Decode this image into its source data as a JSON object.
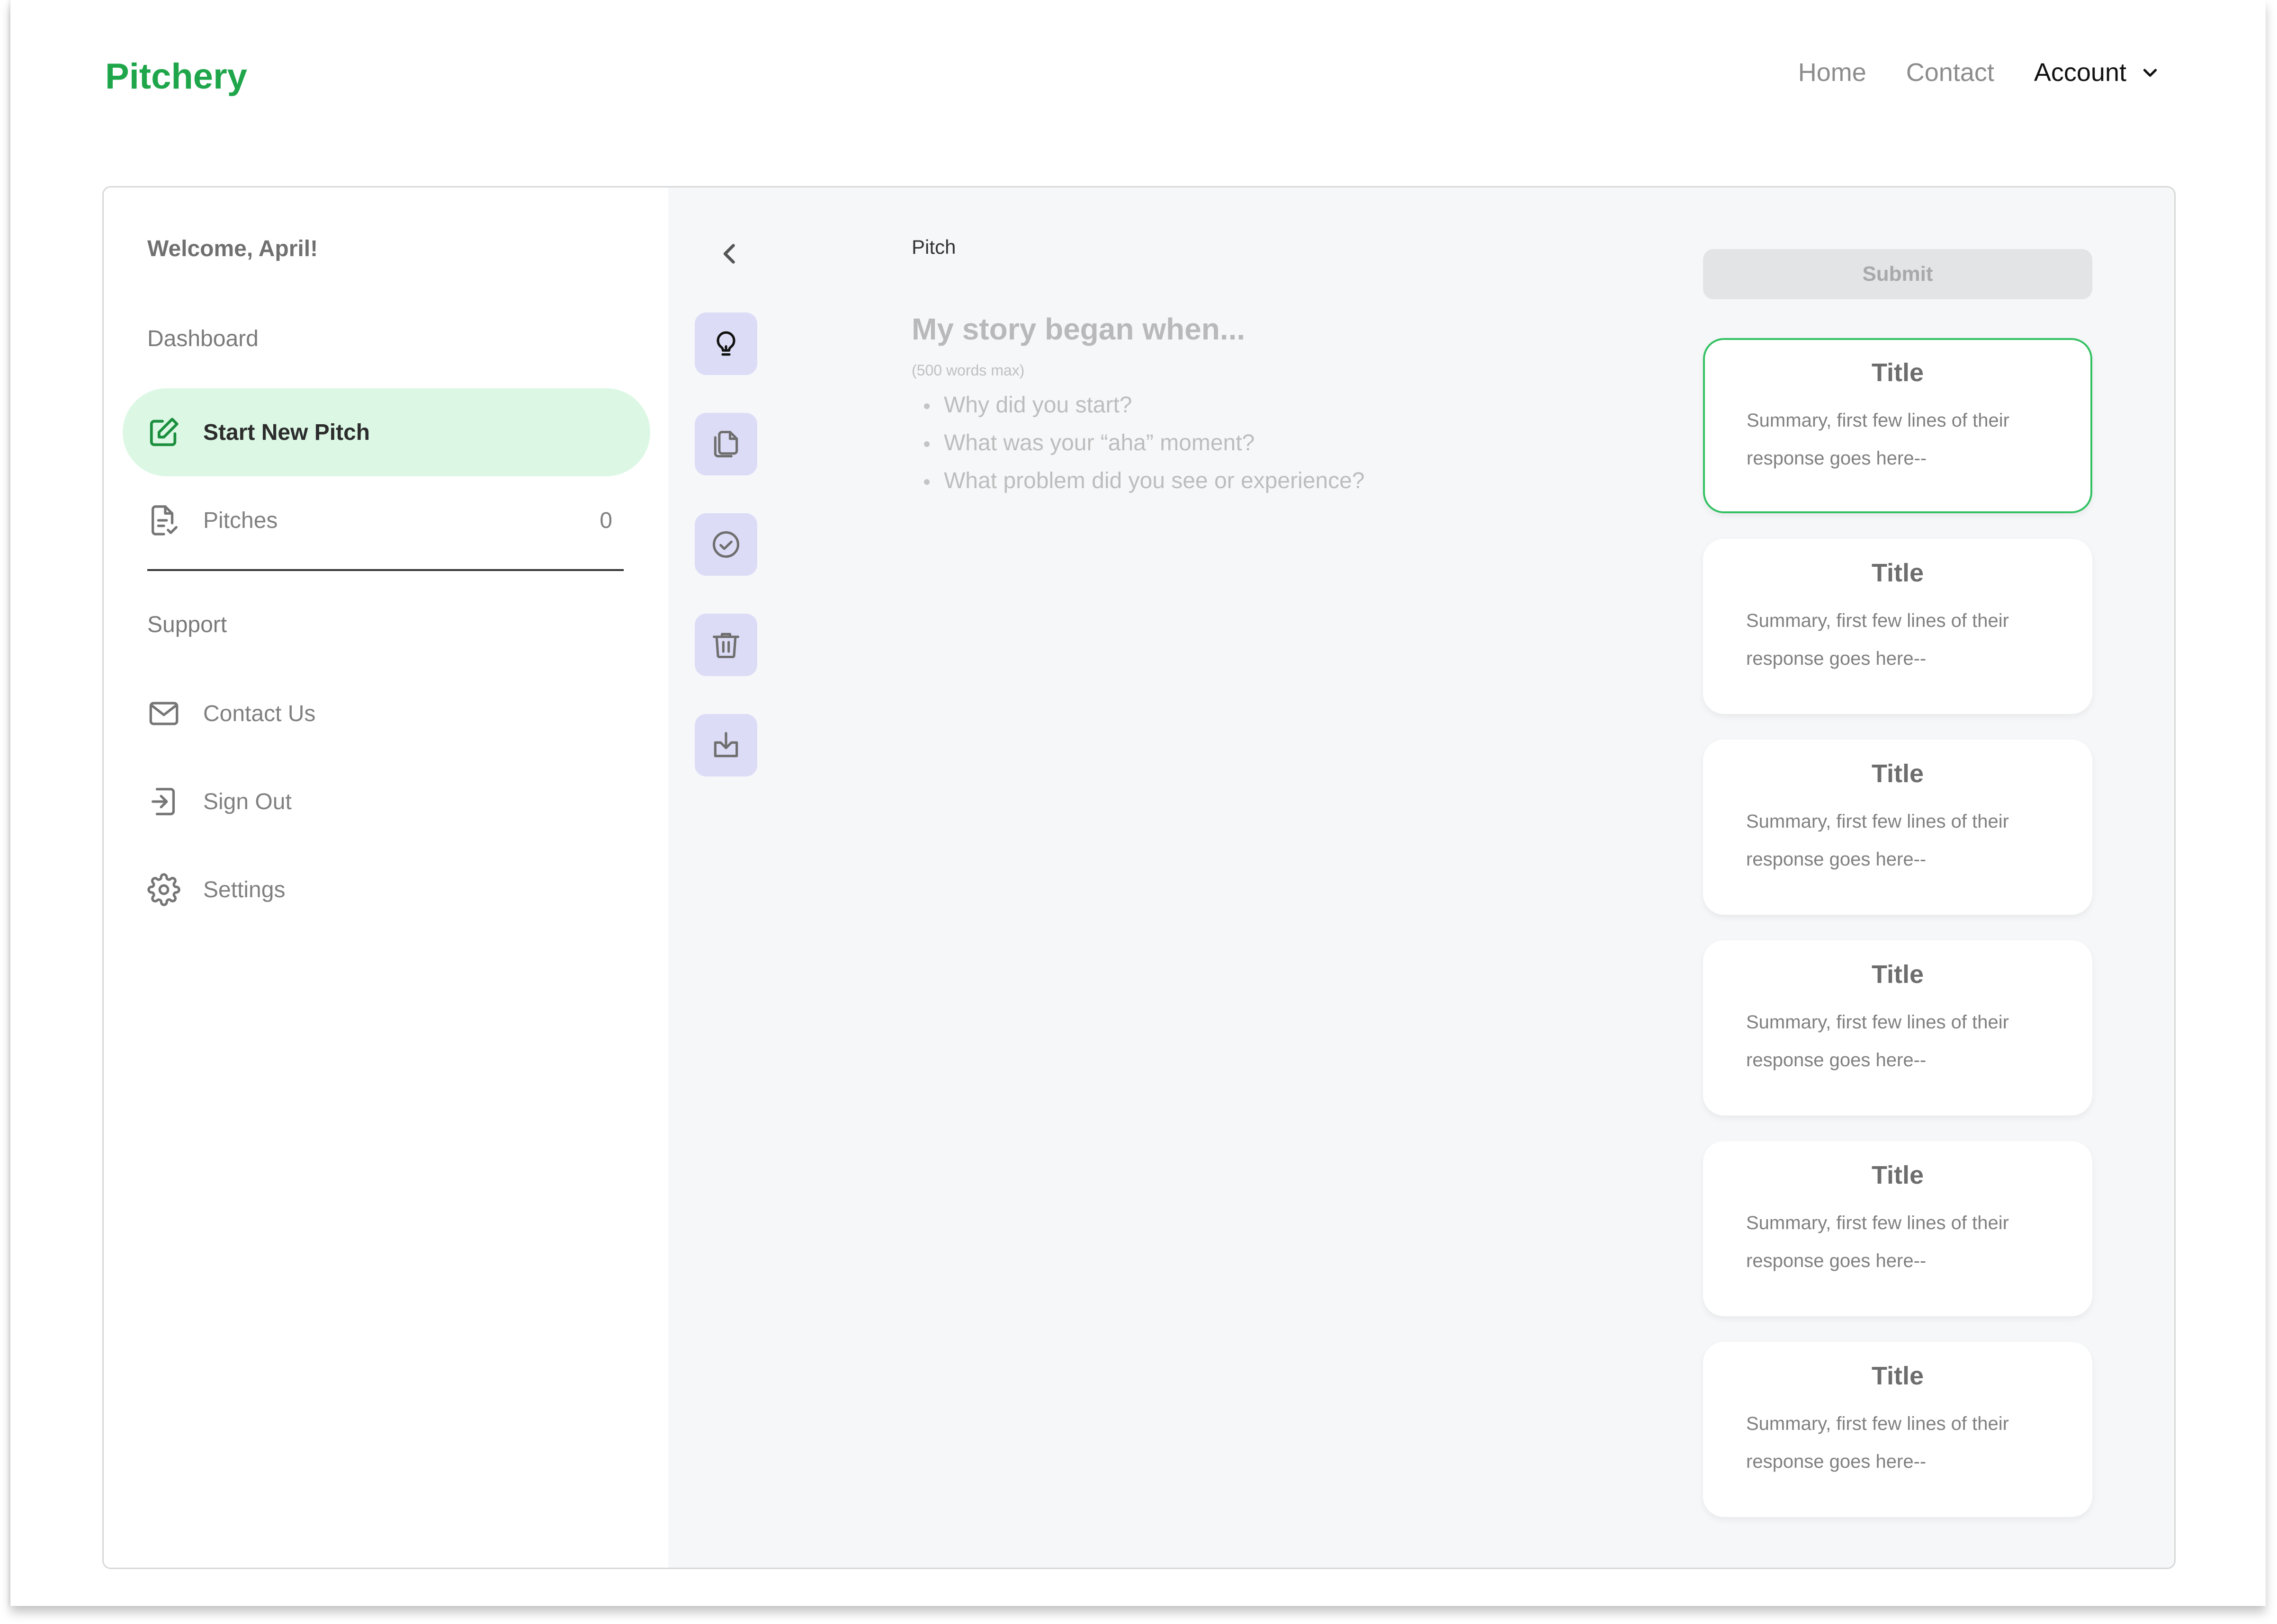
{
  "header": {
    "logo": "Pitchery",
    "nav": [
      {
        "label": "Home"
      },
      {
        "label": "Contact"
      }
    ],
    "account_label": "Account",
    "account_icon": "chevron-down-icon"
  },
  "sidebar": {
    "welcome": "Welcome, April!",
    "section_dashboard": "Dashboard",
    "items": [
      {
        "label": "Start New Pitch",
        "icon": "edit-icon",
        "active": true
      },
      {
        "label": "Pitches",
        "icon": "document-check-icon",
        "count": "0"
      }
    ],
    "section_support": "Support",
    "support_items": [
      {
        "label": "Contact Us",
        "icon": "mail-icon"
      },
      {
        "label": "Sign Out",
        "icon": "sign-out-icon"
      },
      {
        "label": "Settings",
        "icon": "gear-icon"
      }
    ]
  },
  "toolbar": {
    "back_icon": "chevron-left-icon",
    "tools": [
      {
        "name": "idea",
        "icon": "lightbulb-icon"
      },
      {
        "name": "copy",
        "icon": "copy-icon"
      },
      {
        "name": "check",
        "icon": "check-circle-icon"
      },
      {
        "name": "delete",
        "icon": "trash-icon"
      },
      {
        "name": "download",
        "icon": "download-icon"
      }
    ]
  },
  "editor": {
    "section_label": "Pitch",
    "prompt_title": "My story began when...",
    "word_limit": "(500 words max)",
    "prompts": [
      "Why did you start?",
      "What was your “aha” moment?",
      "What problem did you see or experience?"
    ]
  },
  "right_panel": {
    "submit_label": "Submit",
    "cards": [
      {
        "title": "Title",
        "summary": "Summary, first few lines of their response goes here--",
        "selected": true
      },
      {
        "title": "Title",
        "summary": "Summary, first few lines of their response goes here--"
      },
      {
        "title": "Title",
        "summary": "Summary, first few lines of their response goes here--"
      },
      {
        "title": "Title",
        "summary": "Summary, first few lines of their response goes here--"
      },
      {
        "title": "Title",
        "summary": "Summary, first few lines of their response goes here--"
      },
      {
        "title": "Title",
        "summary": "Summary, first few lines of their response goes here--"
      }
    ]
  },
  "colors": {
    "brand": "#1fa64b",
    "active_nav_bg": "#dcf8e5",
    "tool_button_bg": "#dcdcf7",
    "selected_card_border": "#33c162",
    "main_bg": "#f6f7f9"
  }
}
